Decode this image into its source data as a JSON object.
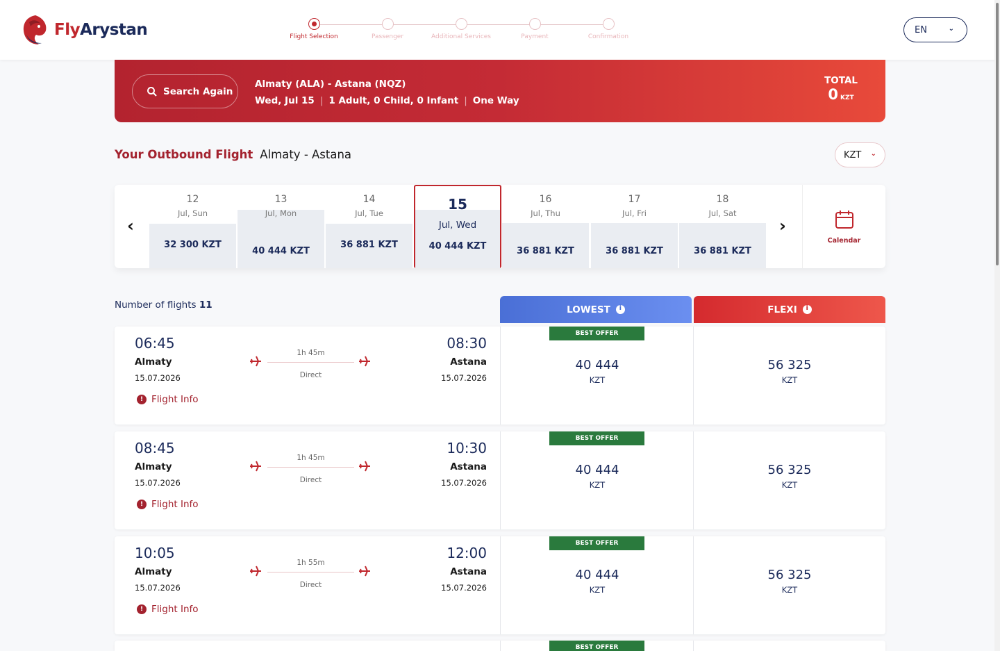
{
  "header": {
    "brand_fly": "Fly",
    "brand_arystan": "Arystan",
    "language": "EN",
    "steps": [
      {
        "label": "Flight Selection",
        "active": true
      },
      {
        "label": "Passenger",
        "active": false
      },
      {
        "label": "Additional Services",
        "active": false
      },
      {
        "label": "Payment",
        "active": false
      },
      {
        "label": "Confirmation",
        "active": false
      }
    ]
  },
  "banner": {
    "search_again": "Search Again",
    "route": "Almaty (ALA) - Astana (NQZ)",
    "date": "Wed, Jul 15",
    "pax": "1 Adult, 0 Child, 0 Infant",
    "trip": "One Way",
    "total_label": "TOTAL",
    "total_value": "0",
    "total_currency": "KZT"
  },
  "outbound": {
    "title": "Your Outbound Flight",
    "route": "Almaty - Astana",
    "currency": "KZT"
  },
  "dates": [
    {
      "num": "12",
      "day": "Jul, Sun",
      "price": "32 300 KZT"
    },
    {
      "num": "13",
      "day": "Jul, Mon",
      "price": "40 444 KZT"
    },
    {
      "num": "14",
      "day": "Jul, Tue",
      "price": "36 881 KZT"
    },
    {
      "num": "15",
      "day": "Jul, Wed",
      "price": "40 444 KZT"
    },
    {
      "num": "16",
      "day": "Jul, Thu",
      "price": "36 881 KZT"
    },
    {
      "num": "17",
      "day": "Jul, Fri",
      "price": "36 881 KZT"
    },
    {
      "num": "18",
      "day": "Jul, Sat",
      "price": "36 881 KZT"
    }
  ],
  "calendar_label": "Calendar",
  "flights_count_label": "Number of flights",
  "flights_count": "11",
  "fare_lowest": "LOWEST",
  "fare_flexi": "FLEXI",
  "best_offer": "BEST OFFER",
  "flight_info": "Flight Info",
  "flights": [
    {
      "dep_time": "06:45",
      "dep_city": "Almaty",
      "dep_date": "15.07.2026",
      "arr_time": "08:30",
      "arr_city": "Astana",
      "arr_date": "15.07.2026",
      "duration": "1h 45m",
      "type": "Direct",
      "lowest": "40 444",
      "lowest_cur": "KZT",
      "flexi": "56 325",
      "flexi_cur": "KZT"
    },
    {
      "dep_time": "08:45",
      "dep_city": "Almaty",
      "dep_date": "15.07.2026",
      "arr_time": "10:30",
      "arr_city": "Astana",
      "arr_date": "15.07.2026",
      "duration": "1h 45m",
      "type": "Direct",
      "lowest": "40 444",
      "lowest_cur": "KZT",
      "flexi": "56 325",
      "flexi_cur": "KZT"
    },
    {
      "dep_time": "10:05",
      "dep_city": "Almaty",
      "dep_date": "15.07.2026",
      "arr_time": "12:00",
      "arr_city": "Astana",
      "arr_date": "15.07.2026",
      "duration": "1h 55m",
      "type": "Direct",
      "lowest": "40 444",
      "lowest_cur": "KZT",
      "flexi": "56 325",
      "flexi_cur": "KZT"
    }
  ],
  "colors": {
    "brand_red": "#c0272d",
    "navy": "#1b2a5a",
    "offer_green": "#2a7a3d",
    "lowest_blue": "#4a6fd6"
  }
}
